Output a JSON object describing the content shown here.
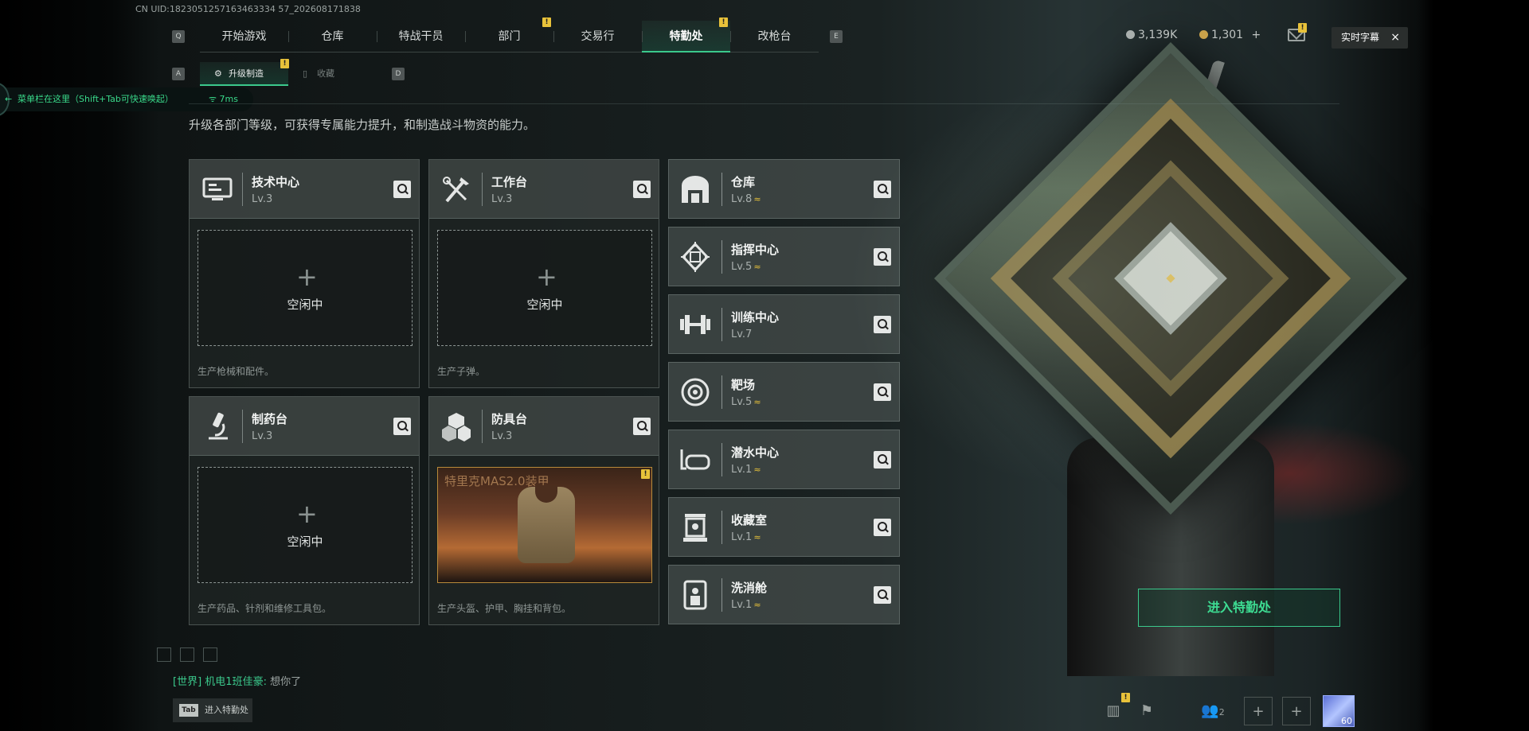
{
  "uid": "CN UID:1823051257163463334 57_202608171838",
  "tabs": {
    "left_key": "Q",
    "right_key": "E",
    "items": [
      {
        "label": "开始游戏",
        "badge": ""
      },
      {
        "label": "仓库",
        "badge": ""
      },
      {
        "label": "特战干员",
        "badge": ""
      },
      {
        "label": "部门",
        "badge": "!"
      },
      {
        "label": "交易行",
        "badge": ""
      },
      {
        "label": "特勤处",
        "badge": "!"
      },
      {
        "label": "改枪台",
        "badge": ""
      }
    ],
    "active": "特勤处"
  },
  "subtabs": {
    "left_key": "A",
    "right_key": "D",
    "items": [
      {
        "label": "升级制造",
        "badge": "!"
      },
      {
        "label": "收藏",
        "badge": ""
      }
    ]
  },
  "menu_hint": {
    "text": "菜单栏在这里（Shift+Tab可快速唤起）",
    "ping": "7ms",
    "arrow": "←"
  },
  "currency": {
    "silver": "3,139K",
    "gold": "1,301",
    "gold_add": "+"
  },
  "mail_badge": "!",
  "subtitle_button": {
    "label": "实时字幕",
    "close": "×"
  },
  "description": "升级各部门等级，可获得专属能力提升，和制造战斗物资的能力。",
  "workshops": [
    {
      "name": "技术中心",
      "level": "Lv.3",
      "icon": "computer-icon",
      "status": "空闲中",
      "plus": "+",
      "footer": "生产枪械和配件。"
    },
    {
      "name": "工作台",
      "level": "Lv.3",
      "icon": "tools-icon",
      "status": "空闲中",
      "plus": "+",
      "footer": "生产子弹。"
    },
    {
      "name": "制药台",
      "level": "Lv.3",
      "icon": "microscope-icon",
      "status": "空闲中",
      "plus": "+",
      "footer": "生产药品、针剂和维修工具包。"
    },
    {
      "name": "防具台",
      "level": "Lv.3",
      "icon": "cubes-icon",
      "item": "特里克MAS2.0装甲",
      "item_badge": "!",
      "footer": "生产头盔、护甲、胸挂和背包。"
    }
  ],
  "facilities": [
    {
      "name": "仓库",
      "level": "Lv.8",
      "upgradable": true,
      "icon": "warehouse-icon"
    },
    {
      "name": "指挥中心",
      "level": "Lv.5",
      "upgradable": true,
      "icon": "chip-icon"
    },
    {
      "name": "训练中心",
      "level": "Lv.7",
      "upgradable": false,
      "icon": "dumbbell-icon"
    },
    {
      "name": "靶场",
      "level": "Lv.5",
      "upgradable": true,
      "icon": "target-icon"
    },
    {
      "name": "潜水中心",
      "level": "Lv.1",
      "upgradable": true,
      "icon": "diving-mask-icon"
    },
    {
      "name": "收藏室",
      "level": "Lv.1",
      "upgradable": true,
      "icon": "display-case-icon"
    },
    {
      "name": "洗消舱",
      "level": "Lv.1",
      "upgradable": true,
      "icon": "decon-pod-icon"
    }
  ],
  "upgrade_symbol": "≈",
  "enter_button": "进入特勤处",
  "chat": {
    "channel": "[世界]",
    "user": "机电1班佳豪:",
    "message": "想你了"
  },
  "tab_hint": {
    "key": "Tab",
    "label": "进入特勤处"
  },
  "bottom_bar": {
    "stats_badge": "!",
    "friends_count": "2",
    "add1": "+",
    "add2": "+",
    "level": "60"
  },
  "colors": {
    "accent": "#3bc98c",
    "badge": "#e8c23a"
  }
}
